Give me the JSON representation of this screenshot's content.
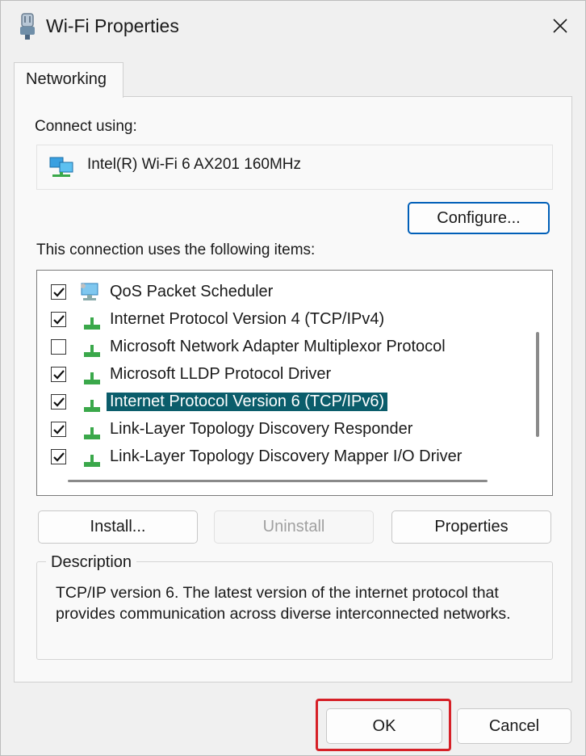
{
  "window": {
    "title": "Wi-Fi Properties"
  },
  "tabs": [
    {
      "label": "Networking"
    }
  ],
  "connect": {
    "label": "Connect using:",
    "adapter": "Intel(R) Wi-Fi 6 AX201 160MHz"
  },
  "buttons": {
    "configure": "Configure...",
    "install": "Install...",
    "uninstall": "Uninstall",
    "properties": "Properties",
    "ok": "OK",
    "cancel": "Cancel"
  },
  "items_label": "This connection uses the following items:",
  "items": [
    {
      "label": "QoS Packet Scheduler",
      "checked": true,
      "icon": "qos-icon"
    },
    {
      "label": "Internet Protocol Version 4 (TCP/IPv4)",
      "checked": true,
      "icon": "protocol-icon"
    },
    {
      "label": "Microsoft Network Adapter Multiplexor Protocol",
      "checked": false,
      "icon": "protocol-icon"
    },
    {
      "label": "Microsoft LLDP Protocol Driver",
      "checked": true,
      "icon": "protocol-icon"
    },
    {
      "label": "Internet Protocol Version 6 (TCP/IPv6)",
      "checked": true,
      "icon": "protocol-icon",
      "selected": true
    },
    {
      "label": "Link-Layer Topology Discovery Responder",
      "checked": true,
      "icon": "protocol-icon"
    },
    {
      "label": "Link-Layer Topology Discovery Mapper I/O Driver",
      "checked": true,
      "icon": "protocol-icon"
    }
  ],
  "description": {
    "legend": "Description",
    "text": "TCP/IP version 6. The latest version of the internet protocol that provides communication across diverse interconnected networks."
  },
  "colors": {
    "accent": "#005fb8",
    "selection": "#0b5d6b",
    "highlight": "#f6ff00",
    "annotation": "#d62027"
  }
}
